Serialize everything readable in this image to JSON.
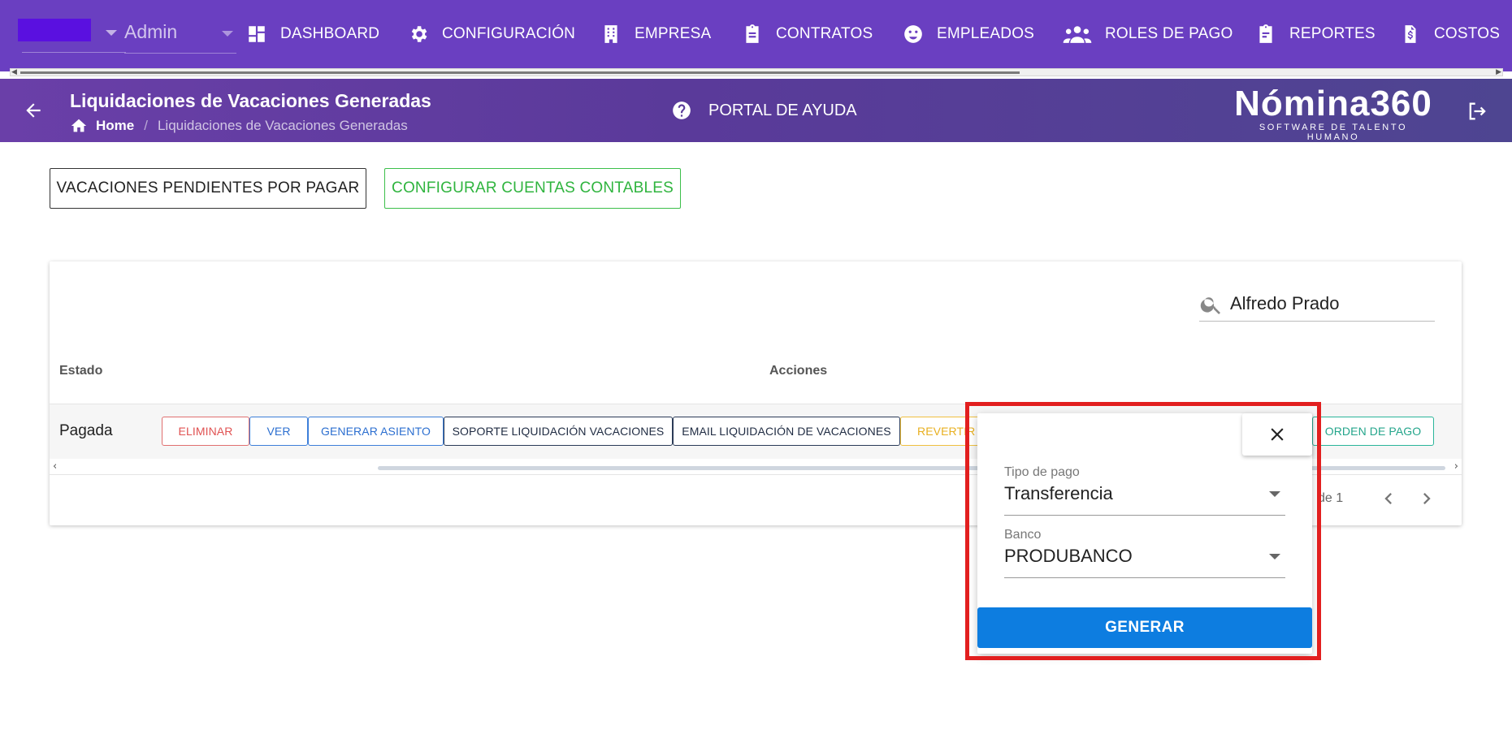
{
  "topnav": {
    "user_label": "Admin",
    "items": [
      {
        "label": "DASHBOARD",
        "icon": "dashboard-icon"
      },
      {
        "label": "CONFIGURACIÓN",
        "icon": "gear-icon"
      },
      {
        "label": "EMPRESA",
        "icon": "building-icon"
      },
      {
        "label": "CONTRATOS",
        "icon": "clipboard-icon"
      },
      {
        "label": "EMPLEADOS",
        "icon": "face-icon"
      },
      {
        "label": "ROLES DE PAGO",
        "icon": "group-icon"
      },
      {
        "label": "REPORTES",
        "icon": "report-icon"
      },
      {
        "label": "COSTOS",
        "icon": "cost-icon"
      }
    ]
  },
  "subheader": {
    "title": "Liquidaciones de Vacaciones Generadas",
    "breadcrumb_home": "Home",
    "breadcrumb_sep": "/",
    "breadcrumb_current": "Liquidaciones de Vacaciones Generadas",
    "help_label": "PORTAL DE AYUDA",
    "logo_main": "Nómina360",
    "logo_sub": "SOFTWARE DE TALENTO HUMANO"
  },
  "actions": {
    "pendientes": "VACACIONES PENDIENTES POR PAGAR",
    "cuentas": "CONFIGURAR CUENTAS CONTABLES"
  },
  "table": {
    "search_value": "Alfredo Prado",
    "headers": {
      "estado": "Estado",
      "acciones": "Acciones"
    },
    "row": {
      "estado": "Pagada",
      "buttons": {
        "eliminar": "ELIMINAR",
        "ver": "VER",
        "asiento": "GENERAR ASIENTO",
        "soporte": "SOPORTE LIQUIDACIÓN VACACIONES",
        "email": "EMAIL LIQUIDACIÓN DE VACACIONES",
        "revertir": "REVERTIR",
        "orden": "ORDEN DE PAGO"
      }
    },
    "pager_text": "de 1"
  },
  "popup": {
    "tipo_label": "Tipo de pago",
    "tipo_value": "Transferencia",
    "banco_label": "Banco",
    "banco_value": "PRODUBANCO",
    "generar": "GENERAR"
  },
  "colors": {
    "nav_bg": "#6a3fc1",
    "accent_blue": "#0d7de0",
    "highlight": "#e21f1f"
  }
}
